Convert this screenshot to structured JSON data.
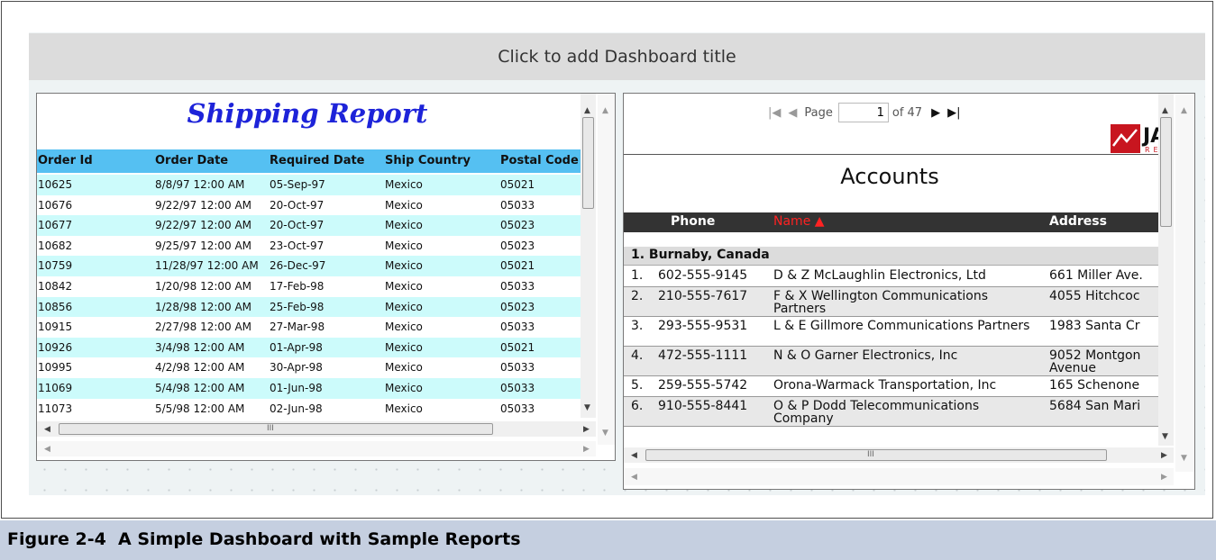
{
  "dashboard": {
    "title": "Click to add Dashboard title"
  },
  "shipping": {
    "title": "Shipping Report",
    "columns": [
      "Order Id",
      "Order Date",
      "Required Date",
      "Ship Country",
      "Postal Code"
    ],
    "rows": [
      [
        "10625",
        "8/8/97 12:00 AM",
        "05-Sep-97",
        "Mexico",
        "05021"
      ],
      [
        "10676",
        "9/22/97 12:00 AM",
        "20-Oct-97",
        "Mexico",
        "05033"
      ],
      [
        "10677",
        "9/22/97 12:00 AM",
        "20-Oct-97",
        "Mexico",
        "05023"
      ],
      [
        "10682",
        "9/25/97 12:00 AM",
        "23-Oct-97",
        "Mexico",
        "05023"
      ],
      [
        "10759",
        "11/28/97 12:00 AM",
        "26-Dec-97",
        "Mexico",
        "05021"
      ],
      [
        "10842",
        "1/20/98 12:00 AM",
        "17-Feb-98",
        "Mexico",
        "05033"
      ],
      [
        "10856",
        "1/28/98 12:00 AM",
        "25-Feb-98",
        "Mexico",
        "05023"
      ],
      [
        "10915",
        "2/27/98 12:00 AM",
        "27-Mar-98",
        "Mexico",
        "05033"
      ],
      [
        "10926",
        "3/4/98 12:00 AM",
        "01-Apr-98",
        "Mexico",
        "05021"
      ],
      [
        "10995",
        "4/2/98 12:00 AM",
        "30-Apr-98",
        "Mexico",
        "05033"
      ],
      [
        "11069",
        "5/4/98 12:00 AM",
        "01-Jun-98",
        "Mexico",
        "05033"
      ],
      [
        "11073",
        "5/5/98 12:00 AM",
        "02-Jun-98",
        "Mexico",
        "05033"
      ]
    ],
    "scroll_grip": "III"
  },
  "accounts": {
    "pager": {
      "page_label": "Page",
      "page_value": "1",
      "of_label": "of 47"
    },
    "logo": {
      "text": "JA",
      "sub": "RE"
    },
    "title": "Accounts",
    "columns": {
      "phone": "Phone",
      "name": "Name ▲",
      "address": "Address"
    },
    "group": "1. Burnaby, Canada",
    "rows": [
      {
        "num": "1.",
        "phone": "602-555-9145",
        "name": "D & Z McLaughlin Electronics, Ltd",
        "address": "661 Miller Ave."
      },
      {
        "num": "2.",
        "phone": "210-555-7617",
        "name": "F & X Wellington Communications Partners",
        "address": "4055 Hitchcoc"
      },
      {
        "num": "3.",
        "phone": "293-555-9531",
        "name": "L & E Gillmore Communications Partners",
        "address": "1983 Santa Cr"
      },
      {
        "num": "4.",
        "phone": "472-555-1111",
        "name": "N & O Garner Electronics, Inc",
        "address": "9052 Montgon Avenue"
      },
      {
        "num": "5.",
        "phone": "259-555-5742",
        "name": "Orona-Warmack Transportation, Inc",
        "address": "165 Schenone"
      },
      {
        "num": "6.",
        "phone": "910-555-8441",
        "name": "O & P Dodd Telecommunications Company",
        "address": "5684 San Mari"
      }
    ],
    "scroll_grip": "III"
  },
  "caption": {
    "number": "Figure 2-4",
    "text": "A Simple Dashboard with Sample Reports"
  },
  "colors": {
    "shipping_header": "#55c0f2",
    "shipping_alt_row": "#ccfbfb",
    "report_title": "#1d23d9",
    "sort_column": "#ff2222",
    "caption_bg": "#c5cfe0"
  }
}
